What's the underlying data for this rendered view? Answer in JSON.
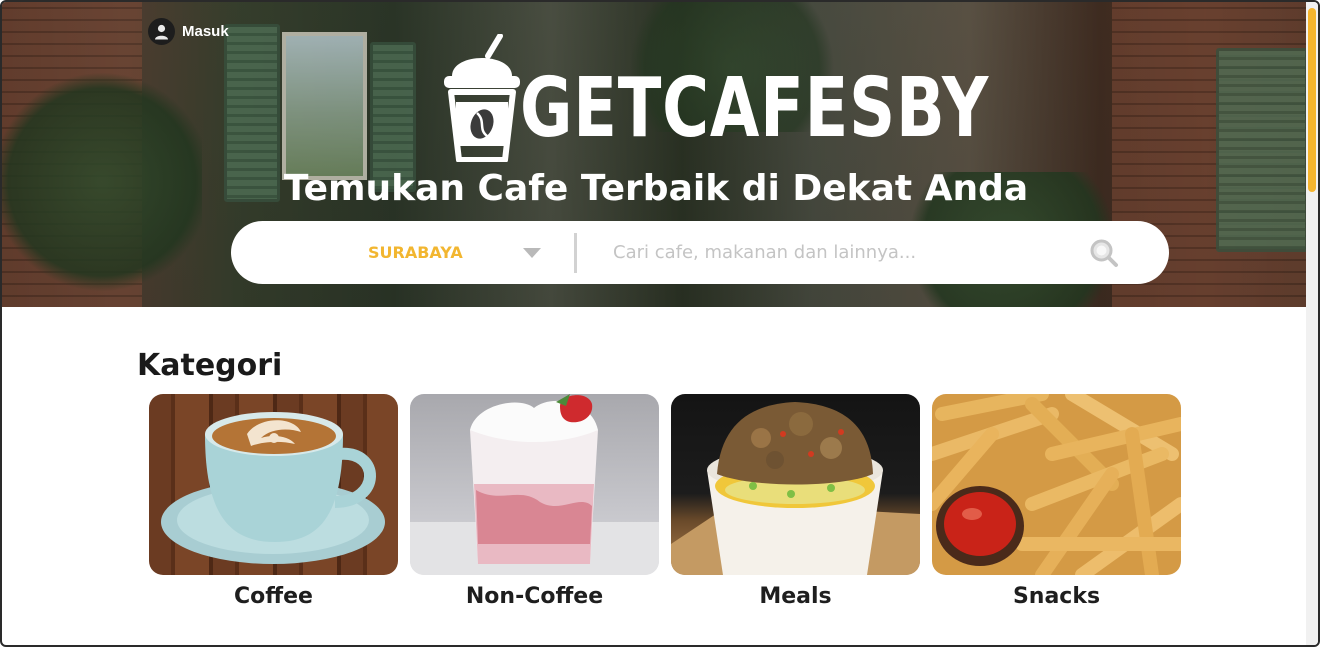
{
  "header": {
    "login_label": "Masuk",
    "logo_text": "GETCAFESBY",
    "tagline": "Temukan Cafe Terbaik di Dekat Anda"
  },
  "search": {
    "city": "SURABAYA",
    "placeholder": "Cari cafe, makanan dan lainnya..."
  },
  "kategori": {
    "title": "Kategori",
    "items": [
      {
        "label": "Coffee",
        "image": "latte-art-cup"
      },
      {
        "label": "Non-Coffee",
        "image": "strawberry-milk-glass"
      },
      {
        "label": "Meals",
        "image": "rice-bowl"
      },
      {
        "label": "Snacks",
        "image": "french-fries-ketchup"
      }
    ]
  },
  "colors": {
    "accent": "#f2b630",
    "scroll_thumb": "#f5b52e",
    "text_dark": "#1a1a1a"
  },
  "icons": {
    "login": "user-icon",
    "search": "search-icon",
    "city_dropdown": "caret-down-icon",
    "logo": "cafe-cup-icon"
  }
}
